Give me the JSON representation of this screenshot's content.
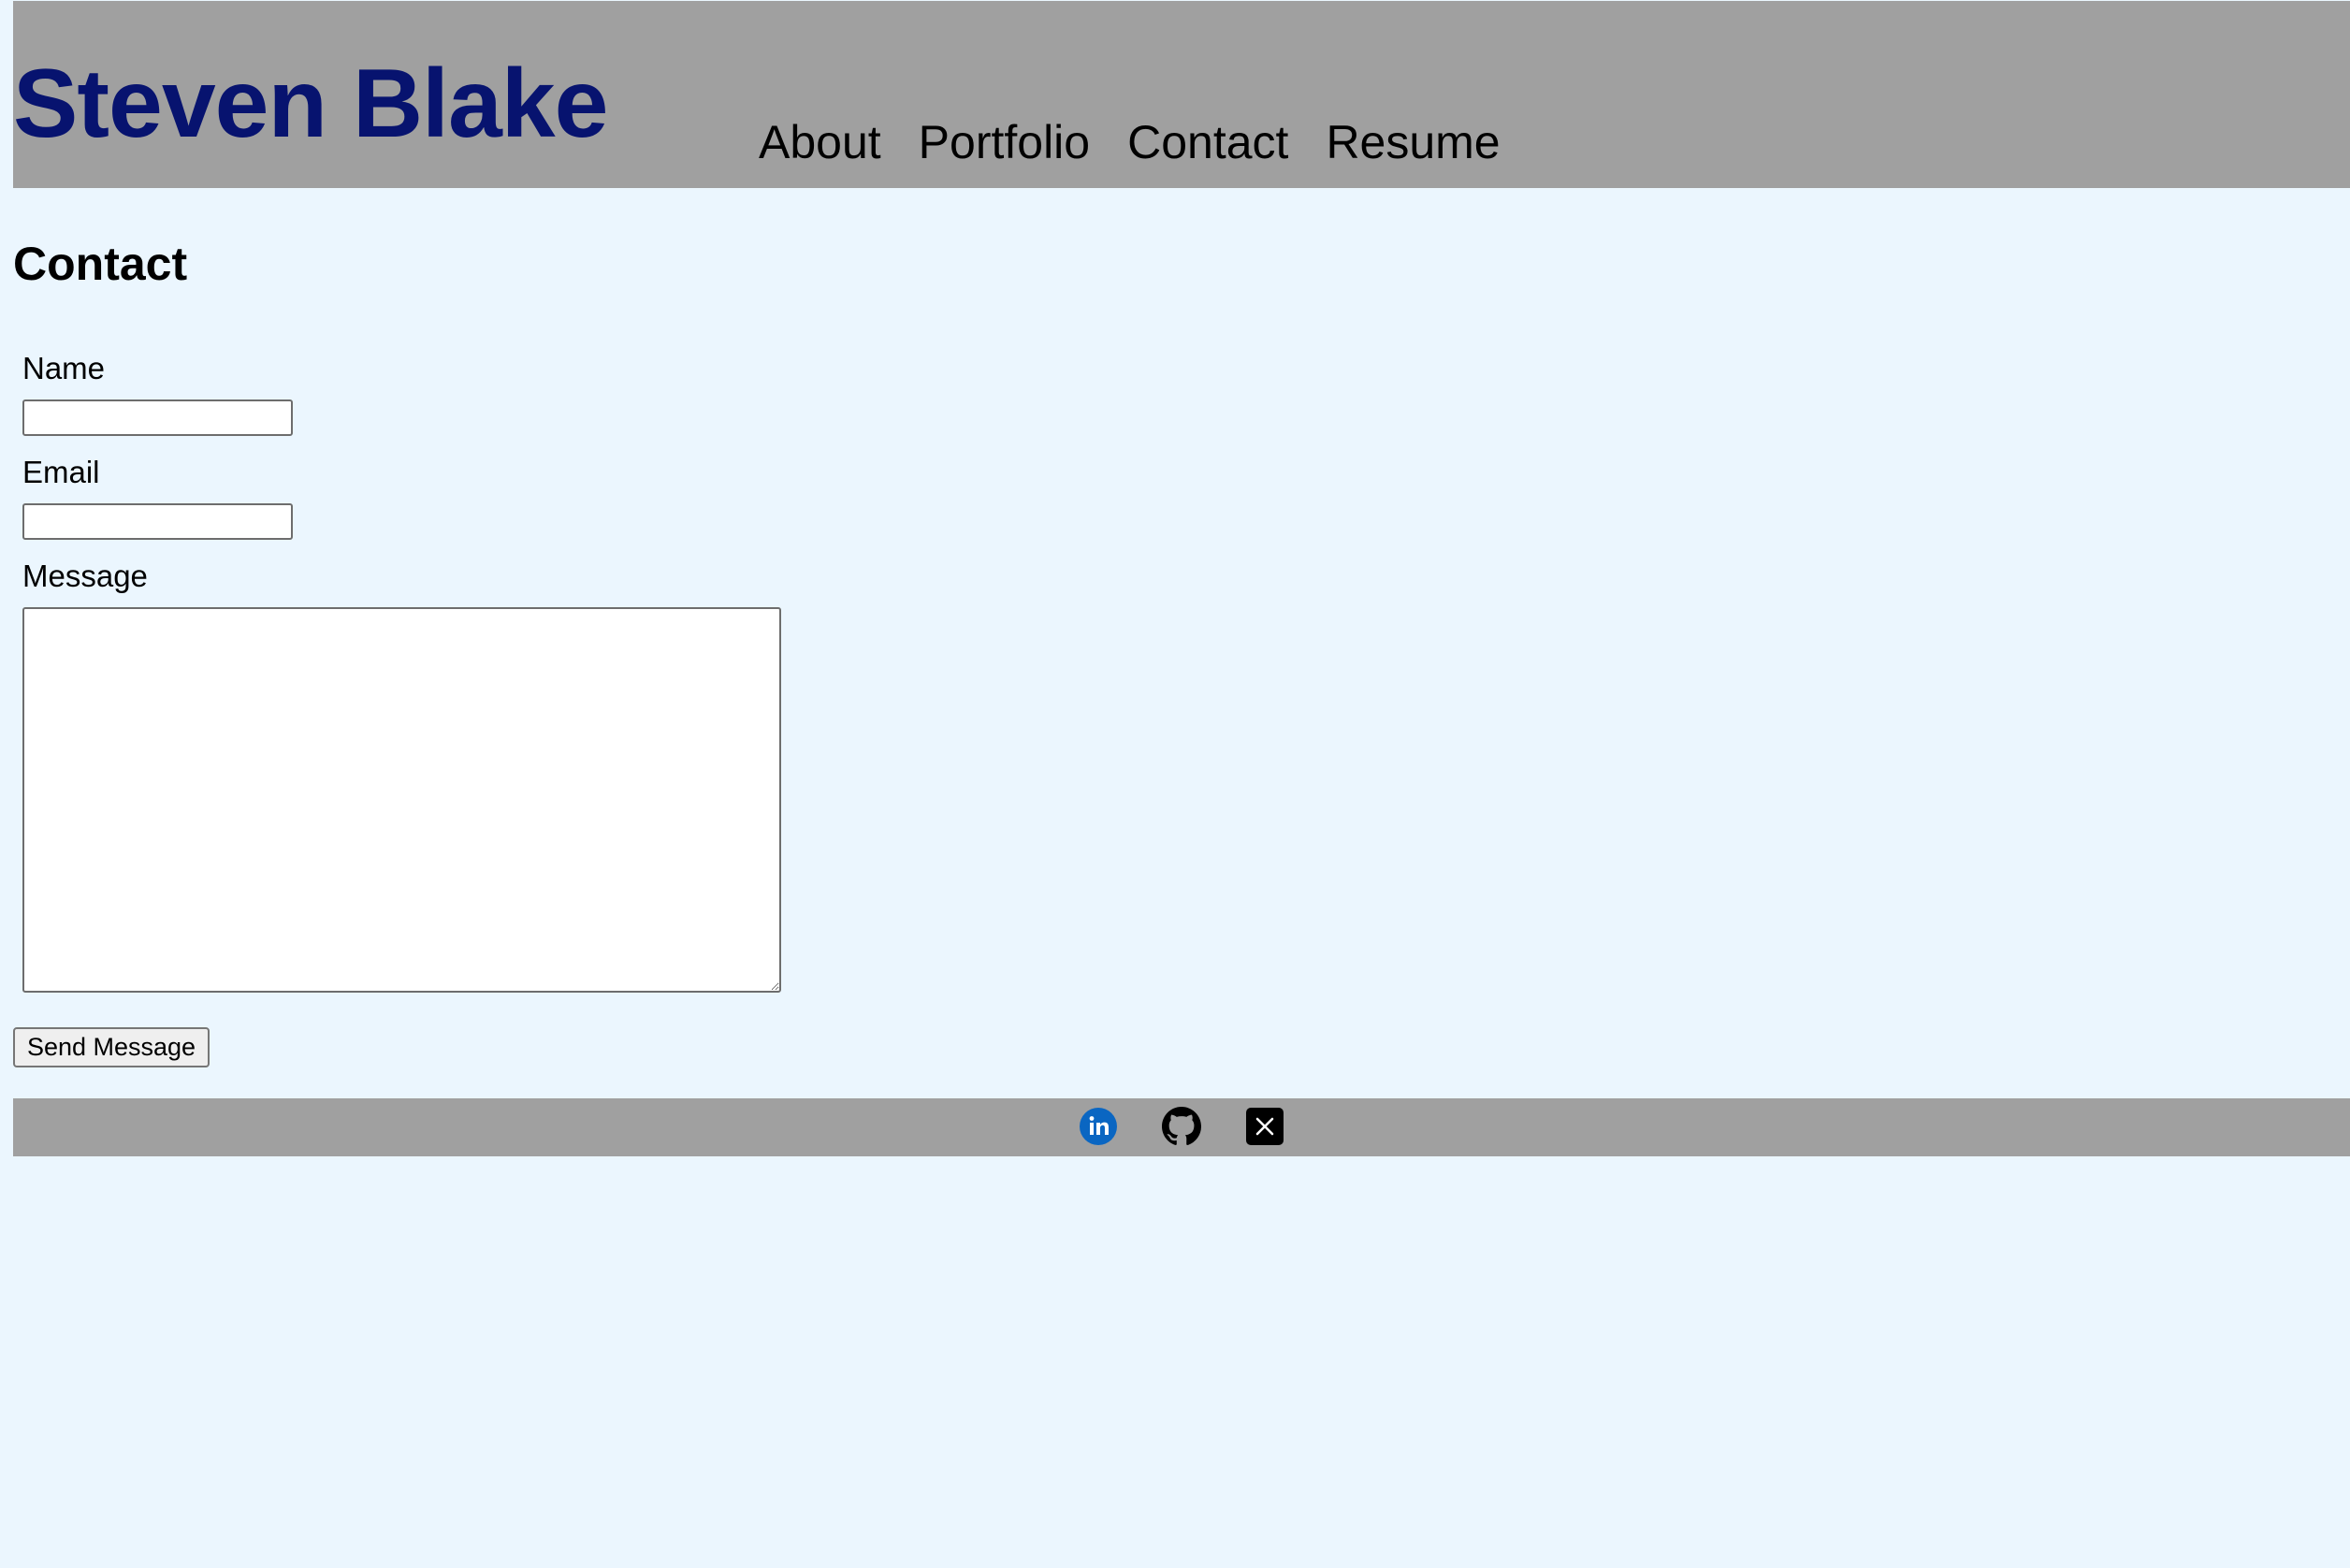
{
  "header": {
    "site_title": "Steven Blake",
    "title_color": "#07136f",
    "background_color": "#a0a0a0",
    "nav": [
      {
        "label": "About"
      },
      {
        "label": "Portfolio"
      },
      {
        "label": "Contact"
      },
      {
        "label": "Resume"
      }
    ]
  },
  "main": {
    "heading": "Contact",
    "background_color": "#ebf6fe",
    "form": {
      "name_label": "Name",
      "name_value": "",
      "email_label": "Email",
      "email_value": "",
      "message_label": "Message",
      "message_value": "",
      "submit_label": "Send Message"
    }
  },
  "footer": {
    "background_color": "#a0a0a0",
    "social_links": [
      {
        "icon": "linkedin-icon",
        "color": "#0a66c2"
      },
      {
        "icon": "github-icon",
        "color": "#000000"
      },
      {
        "icon": "x-icon",
        "color": "#000000"
      }
    ]
  }
}
